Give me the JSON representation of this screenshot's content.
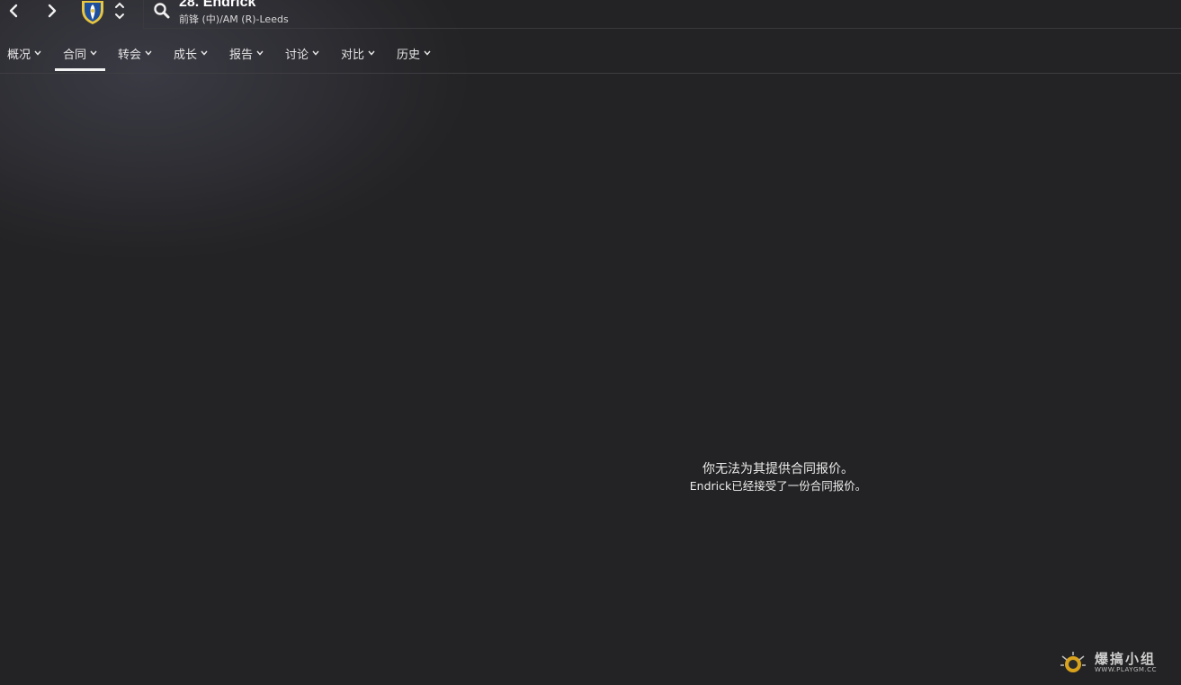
{
  "header": {
    "player_name": "28. Endrick",
    "player_subtitle": "前锋 (中)/AM (R)-Leeds"
  },
  "icons": {
    "back": "chevron-left-icon",
    "forward": "chevron-right-icon",
    "club": "club-crest-icon",
    "prev_next": "up-down-chevron-icon",
    "search": "search-icon"
  },
  "menu": {
    "items": [
      {
        "label": "概况",
        "active": false
      },
      {
        "label": "合同",
        "active": true
      },
      {
        "label": "转会",
        "active": false
      },
      {
        "label": "成长",
        "active": false
      },
      {
        "label": "报告",
        "active": false
      },
      {
        "label": "讨论",
        "active": false
      },
      {
        "label": "对比",
        "active": false
      },
      {
        "label": "历史",
        "active": false
      }
    ]
  },
  "main": {
    "message_line1": "你无法为其提供合同报价。",
    "message_line2": "Endrick已经接受了一份合同报价。"
  },
  "watermark": {
    "text": "爆搞小组",
    "url": "WWW.PLAYGM.CC"
  },
  "colors": {
    "background": "#232325",
    "text": "#e8e8e8",
    "crest_yellow": "#e8c640",
    "crest_blue": "#1d4f9c"
  }
}
